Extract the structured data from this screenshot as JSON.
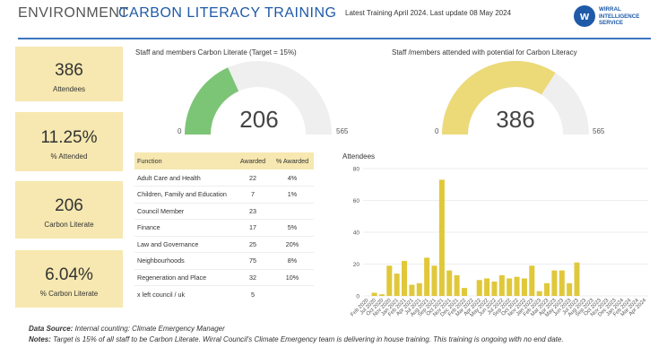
{
  "header": {
    "section": "ENVIRONMENT",
    "title": "CARBON LITERACY TRAINING",
    "subtitle": "Latest Training April 2024. Last update 08 May 2024",
    "logo_lines": [
      "WIRRAL",
      "INTELLIGENCE",
      "SERVICE"
    ],
    "logo_glyph": "w"
  },
  "cards": [
    {
      "value": "386",
      "label": "Attendees"
    },
    {
      "value": "11.25%",
      "label": "% Attended"
    },
    {
      "value": "206",
      "label": "Carbon Literate"
    },
    {
      "value": "6.04%",
      "label": "% Carbon Literate"
    }
  ],
  "gauge1": {
    "title": "Staff and members Carbon Literate (Target = 15%)",
    "value": 206,
    "min": 0,
    "max": 565,
    "value_text": "206",
    "min_text": "0",
    "max_text": "565",
    "color": "#7cc576"
  },
  "gauge2": {
    "title": "Staff /members attended with potential for Carbon Literacy",
    "value": 386,
    "min": 0,
    "max": 565,
    "value_text": "386",
    "min_text": "0",
    "max_text": "565",
    "color": "#ecd978"
  },
  "table": {
    "headers": [
      "Function",
      "Awarded",
      "% Awarded"
    ],
    "rows": [
      [
        "Adult Care and Health",
        "22",
        "4%"
      ],
      [
        "Children, Family and Education",
        "7",
        "1%"
      ],
      [
        "Council Member",
        "23",
        ""
      ],
      [
        "Finance",
        "17",
        "5%"
      ],
      [
        "Law and Governance",
        "25",
        "20%"
      ],
      [
        "Neighbourhoods",
        "75",
        "8%"
      ],
      [
        "Regeneration and Place",
        "32",
        "10%"
      ],
      [
        "x left council / uk",
        "5",
        ""
      ]
    ]
  },
  "chart_data": {
    "type": "bar",
    "title": "Attendees",
    "categories": [
      "Feb 2020",
      "Jun 2020",
      "Jul 2020",
      "Oct 2020",
      "Nov 2020",
      "Jan 2021",
      "Feb 2021",
      "Apr 2021",
      "Jul 2021",
      "Aug 2021",
      "Sep 2021",
      "Oct 2021",
      "Nov 2021",
      "Dec 2021",
      "Feb 2022",
      "Mar 2022",
      "Apr 2022",
      "May 2022",
      "Jun 2022",
      "Jul 2022",
      "Sep 2022",
      "Oct 2022",
      "Nov 2022",
      "Jan 2023",
      "Feb 2023",
      "Mar 2023",
      "Apr 2023",
      "May 2023",
      "Jun 2023",
      "Jul 2023",
      "Aug 2023",
      "Sep 2023",
      "Oct 2023",
      "Nov 2023",
      "Dec 2023",
      "Jan 2024",
      "Feb 2024",
      "Mar 2024",
      "Apr 2024"
    ],
    "tick_labels": [
      "Feb 2020",
      "Jul 2020",
      "Oct 2020",
      "Nov 2020",
      "Jan 2021",
      "Feb 2021",
      "Apr 2021",
      "Jul 2021",
      "Aug 2021",
      "Sep 2021",
      "Oct 2021",
      "Nov 2021",
      "Dec 2021",
      "Feb 2022",
      "Mar 2022",
      "Apr 2022",
      "May 2022",
      "Jun 2022",
      "Jul 2022",
      "Sep 2022",
      "Oct 2022",
      "Nov 2022",
      "Jan 2023",
      "Feb 2023",
      "Mar 2023",
      "Apr 2023",
      "May 2023",
      "Jun 2023",
      "Jul 2023",
      "Aug 2023",
      "Sep 2023",
      "Oct 2023",
      "Nov 2023",
      "Dec 2023",
      "Jan 2024",
      "Feb 2024",
      "Mar 2024",
      "Apr 2024"
    ],
    "values": [
      0,
      2,
      1,
      19,
      14,
      22,
      7,
      8,
      24,
      19,
      73,
      16,
      13,
      5,
      0,
      10,
      11,
      9,
      13,
      11,
      12,
      11,
      19,
      3,
      8,
      16,
      16,
      8,
      21,
      0,
      0,
      0,
      0,
      0,
      0,
      0,
      0,
      0,
      0
    ],
    "ylim": [
      0,
      80
    ],
    "yticks": [
      0,
      20,
      40,
      60,
      80
    ],
    "grid": true,
    "color": "#e0c83a"
  },
  "notes": {
    "source_label": "Data Source:",
    "source_text": " Internal counting: Climate Emergency Manager",
    "notes_label": "Notes:",
    "notes_text": " Target is 15% of all staff to be Carbon Literate. Wirral Council's Climate Emergency team is delivering in house training. This training is ongoing with no end date."
  }
}
